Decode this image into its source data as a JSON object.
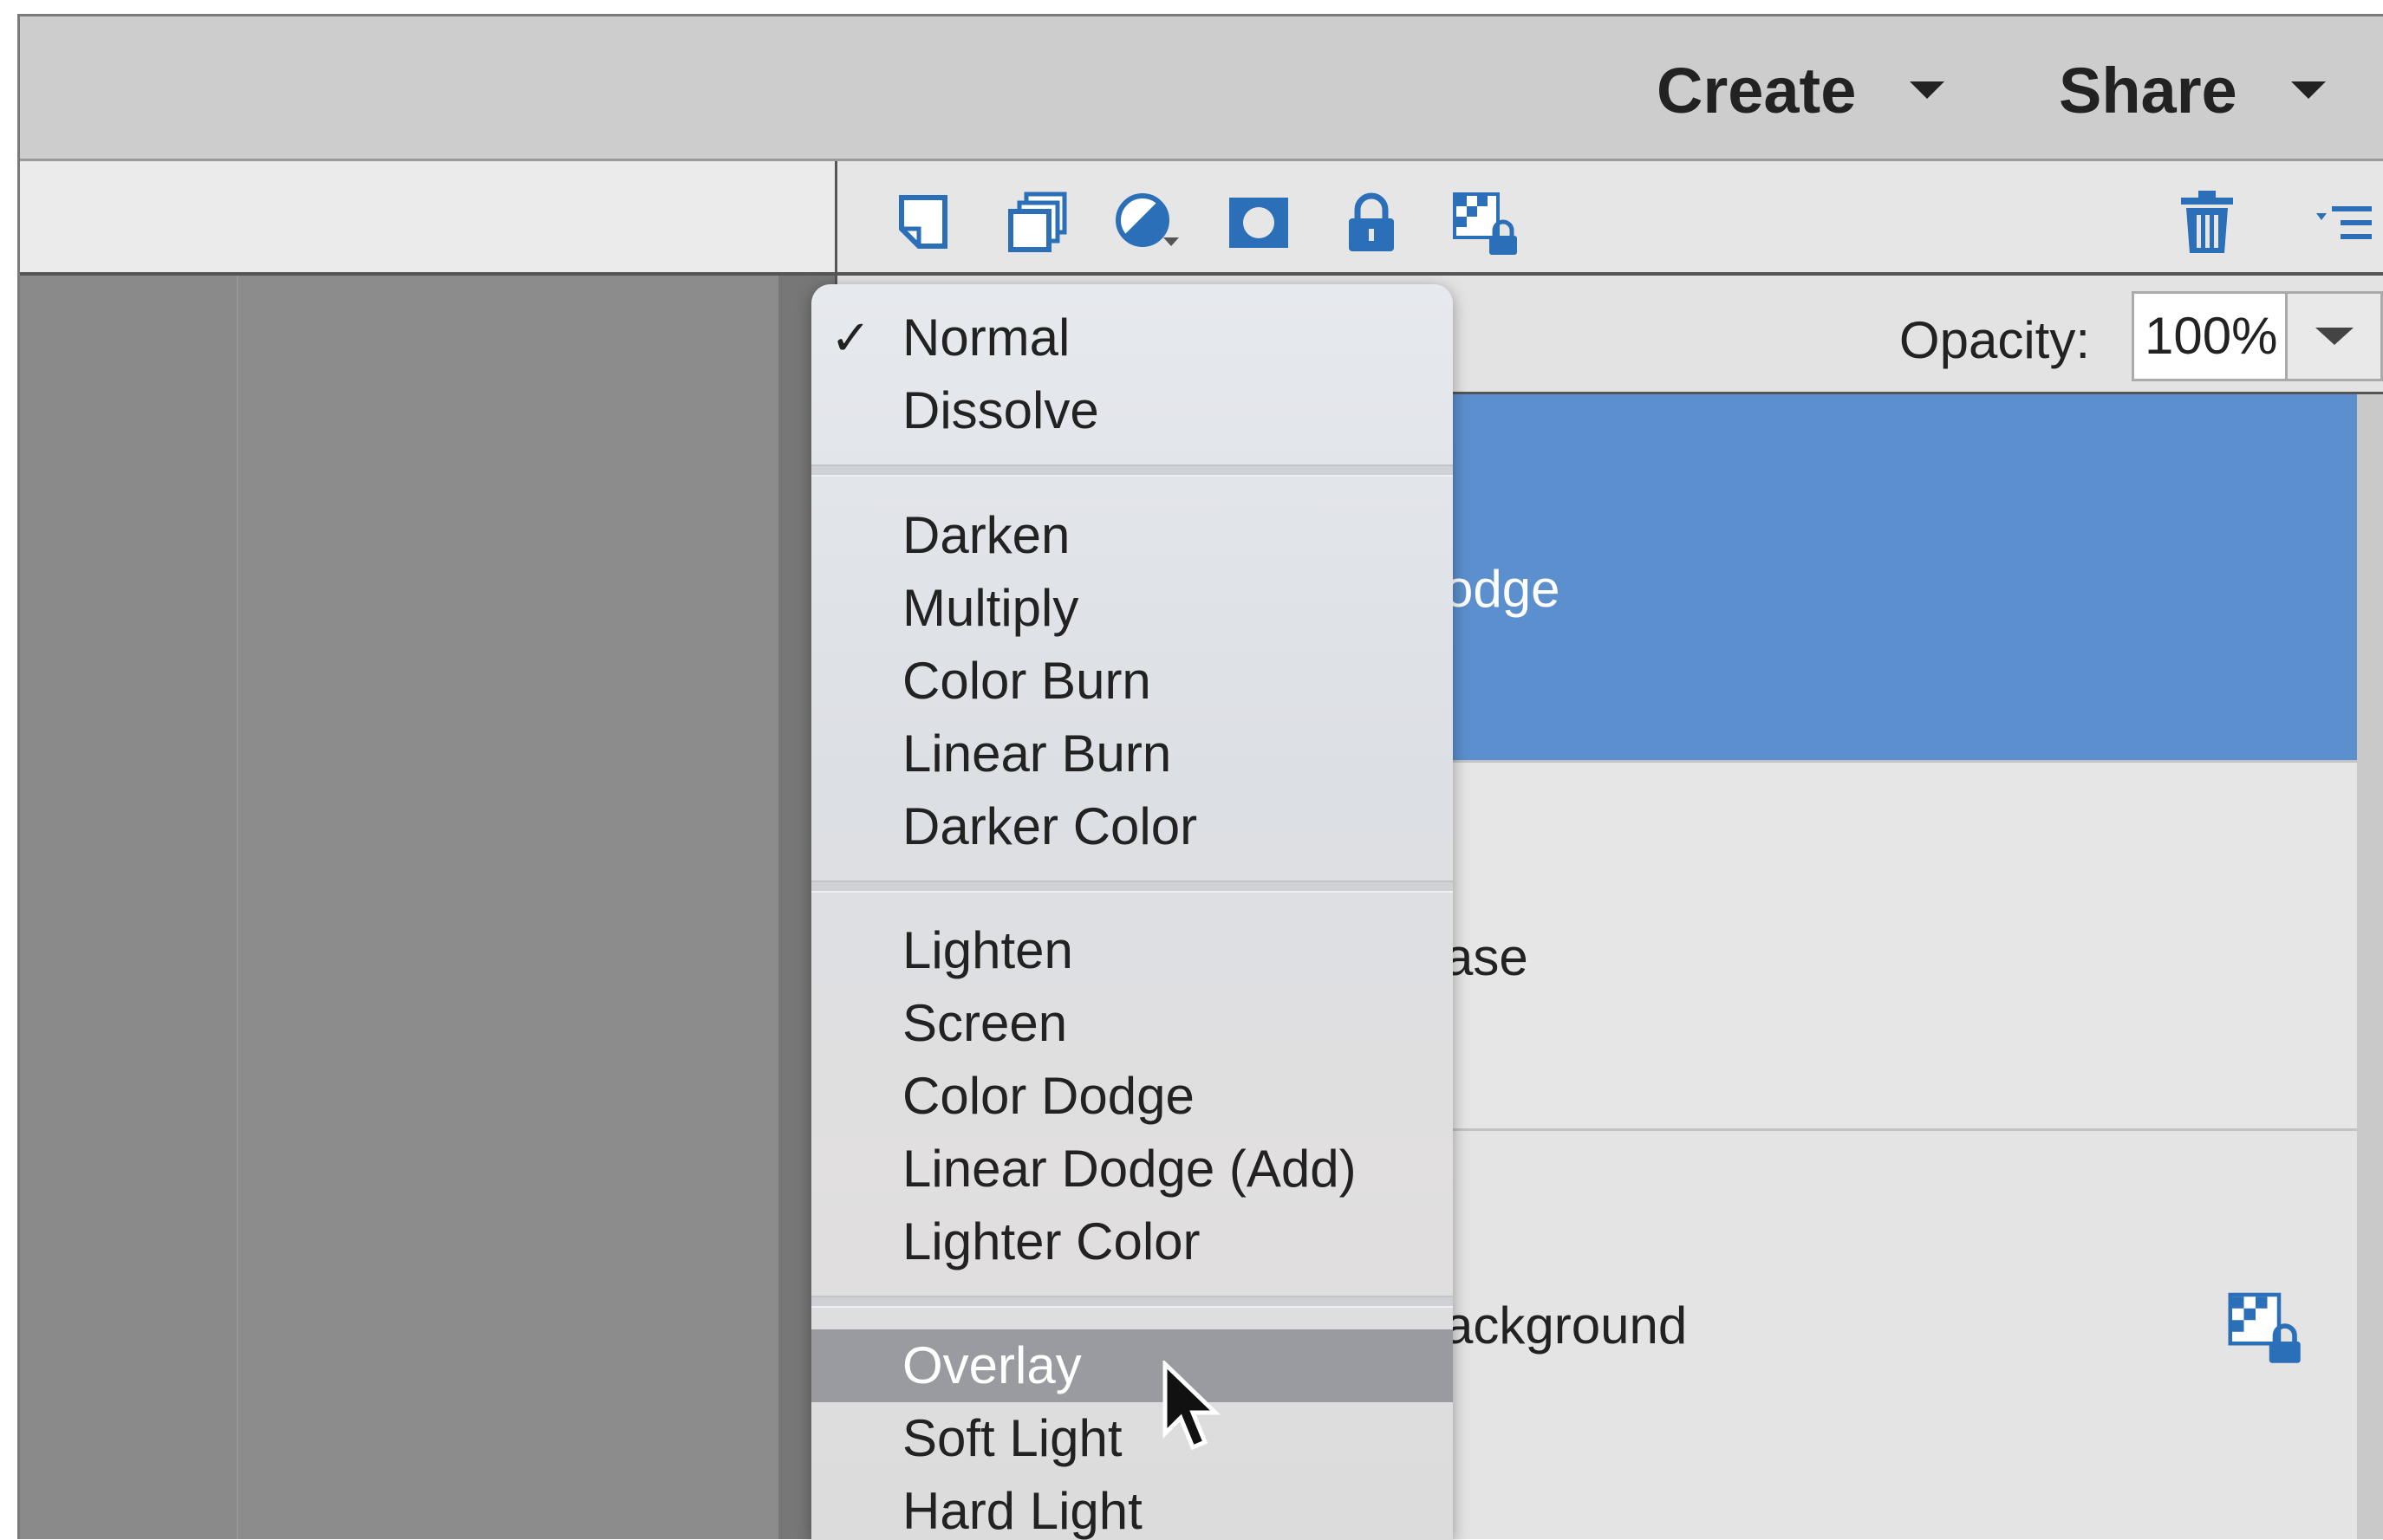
{
  "topbar": {
    "create_label": "Create",
    "share_label": "Share"
  },
  "toolbar": {
    "icons": [
      "new-layer-icon",
      "new-group-icon",
      "adjustment-layer-icon",
      "layer-mask-icon",
      "lock-icon",
      "lock-transparency-icon",
      "trash-icon",
      "panel-menu-icon"
    ]
  },
  "opacity": {
    "label": "Opacity:",
    "value": "100%"
  },
  "layers": [
    {
      "name": "odge",
      "selected": true
    },
    {
      "name": "ase",
      "selected": false
    },
    {
      "name": "ackground",
      "selected": false,
      "locked": true
    }
  ],
  "blend_menu": {
    "checked": "Normal",
    "highlighted": "Overlay",
    "group1": [
      "Normal",
      "Dissolve"
    ],
    "group2": [
      "Darken",
      "Multiply",
      "Color Burn",
      "Linear Burn",
      "Darker Color"
    ],
    "group3": [
      "Lighten",
      "Screen",
      "Color Dodge",
      "Linear Dodge (Add)",
      "Lighter Color"
    ],
    "group4": [
      "Overlay",
      "Soft Light",
      "Hard Light"
    ]
  },
  "colors": {
    "selected_layer": "#5b8fcd",
    "icon_blue": "#2a6fb8",
    "menu_highlight": "#9a9ba0"
  }
}
